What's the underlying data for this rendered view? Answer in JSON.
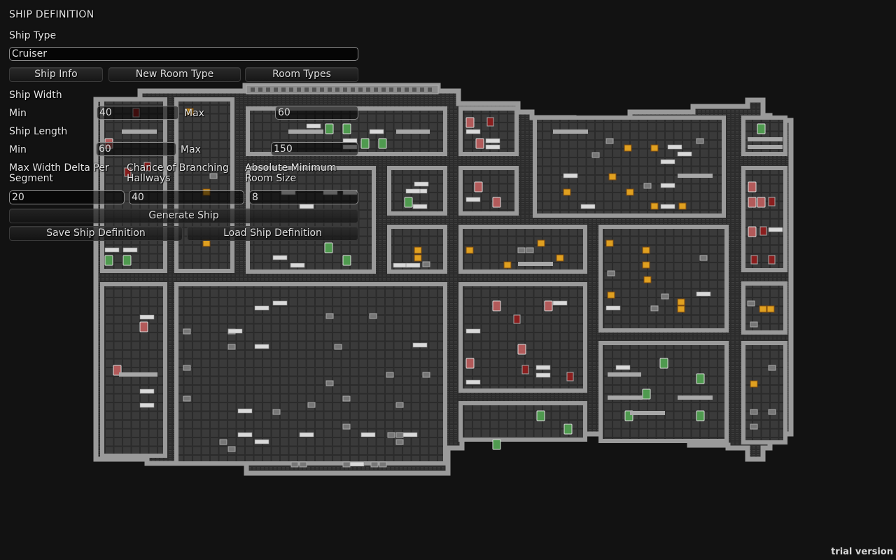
{
  "panel": {
    "title": "SHIP DEFINITION",
    "ship_type_label": "Ship Type",
    "ship_type_value": "Cruiser",
    "buttons": {
      "ship_info": "Ship Info",
      "new_room_type": "New Room Type",
      "room_types": "Room Types",
      "generate_ship": "Generate Ship",
      "save_definition": "Save Ship Definition",
      "load_definition": "Load Ship Definition"
    },
    "ship_width": {
      "label": "Ship Width",
      "min_label": "Min",
      "min_value": "40",
      "max_label": "Max",
      "max_value": "60"
    },
    "ship_length": {
      "label": "Ship Length",
      "min_label": "Min",
      "min_value": "60",
      "max_label": "Max",
      "max_value": "150"
    },
    "max_width_delta": {
      "label_line1": "Max Width Delta Per",
      "label_line2": "Segment",
      "value": "20"
    },
    "branching": {
      "label_line1": "Chance of Branching",
      "label_line2": "Hallways",
      "value": "40"
    },
    "min_room_size": {
      "label_line1": "Absolute Minimum",
      "label_line2": "Room Size",
      "value": "8"
    }
  },
  "footer": {
    "trial_label": "trial version"
  },
  "colors": {
    "background": "#121212",
    "floor": "#3a3a3a",
    "wall": "#9a9a9a",
    "corridor": "#2c2c2c",
    "bed_red": "#b25a5a",
    "bed_green": "#4f9a4f",
    "crate_orange": "#e0a020"
  },
  "map": {
    "description": "Generated ship layout",
    "furniture_types": [
      "red-bed",
      "green-pod",
      "orange-crate",
      "table",
      "console",
      "chair-red"
    ]
  }
}
